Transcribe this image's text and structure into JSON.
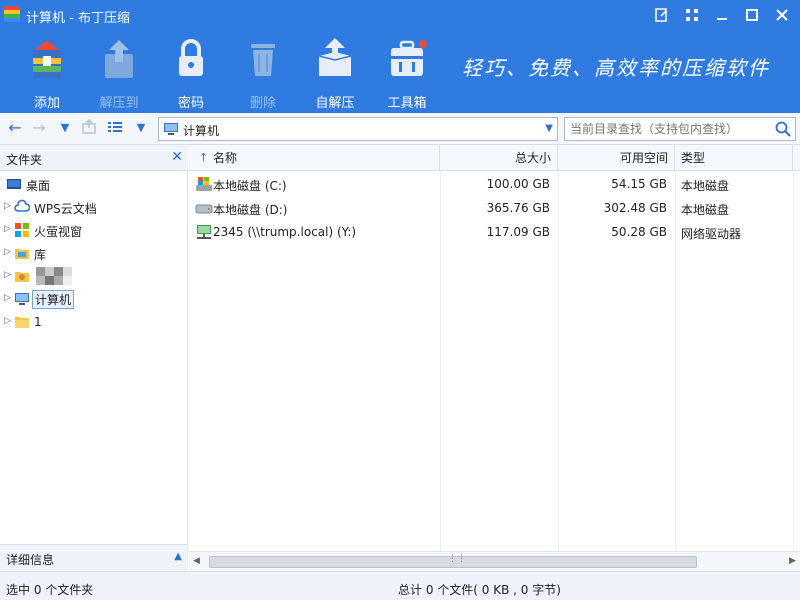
{
  "window": {
    "title": "计算机 - 布丁压缩",
    "controls": [
      "edit-icon",
      "grid-icon",
      "minimize-icon",
      "maximize-icon",
      "close-icon"
    ]
  },
  "toolbar": {
    "add": "添加",
    "extract": "解压到",
    "password": "密码",
    "delete": "删除",
    "self_extract": "自解压",
    "toolbox": "工具箱",
    "slogan": "轻巧、免费、高效率的压缩软件"
  },
  "address": {
    "path": "计算机",
    "search_placeholder": "当前目录查找（支持包内查找）"
  },
  "left_pane": {
    "header": "文件夹",
    "items": [
      {
        "label": "桌面"
      },
      {
        "label": "WPS云文档"
      },
      {
        "label": "火萤视窗"
      },
      {
        "label": "库"
      },
      {
        "label": ""
      },
      {
        "label": "计算机"
      },
      {
        "label": "1"
      }
    ],
    "details_label": "详细信息"
  },
  "columns": {
    "name": "名称",
    "total": "总大小",
    "free": "可用空间",
    "type": "类型"
  },
  "rows": [
    {
      "name": "本地磁盘 (C:)",
      "total": "100.00 GB",
      "free": "54.15 GB",
      "type": "本地磁盘"
    },
    {
      "name": "本地磁盘 (D:)",
      "total": "365.76 GB",
      "free": "302.48 GB",
      "type": "本地磁盘"
    },
    {
      "name": "2345 (\\\\trump.local) (Y:)",
      "total": "117.09 GB",
      "free": "50.28 GB",
      "type": "网络驱动器"
    }
  ],
  "status": {
    "selected": "选中 0 个文件夹",
    "summary": "总计 0 个文件( 0 KB , 0 字节)"
  },
  "colors": {
    "brand_blue": "#2f7be0"
  }
}
